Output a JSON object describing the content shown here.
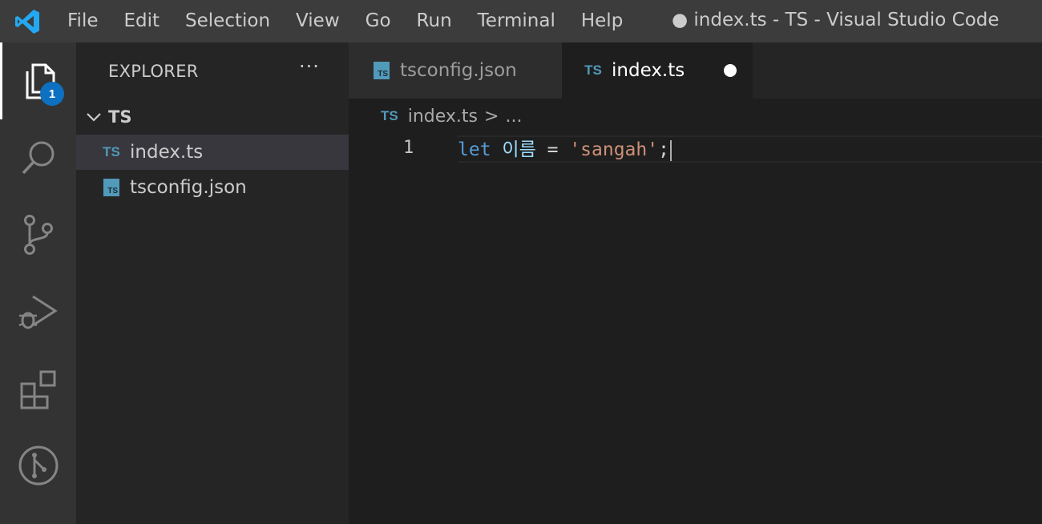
{
  "titlebar": {
    "menu": [
      "File",
      "Edit",
      "Selection",
      "View",
      "Go",
      "Run",
      "Terminal",
      "Help"
    ],
    "window_title": "● index.ts - TS - Visual Studio Code"
  },
  "activity_bar": {
    "items": [
      "explorer-icon",
      "search-icon",
      "source-control-icon",
      "run-debug-icon",
      "extensions-icon",
      "git-graph-icon"
    ],
    "explorer_badge": "1"
  },
  "sidebar": {
    "title": "EXPLORER",
    "more_label": "···",
    "folder": "TS",
    "files": [
      {
        "name": "index.ts",
        "icon": "TS"
      },
      {
        "name": "tsconfig.json",
        "icon": "TS"
      }
    ]
  },
  "tabs": [
    {
      "label": "tsconfig.json",
      "icon": "TS"
    },
    {
      "label": "index.ts",
      "icon": "TS"
    }
  ],
  "breadcrumb": {
    "icon": "TS",
    "file": "index.ts",
    "separator": ">",
    "rest": "..."
  },
  "editor": {
    "line_number": "1",
    "code": {
      "keyword": "let",
      "variable": "이름",
      "operator": "=",
      "string": "'sangah'",
      "end": ";"
    }
  },
  "colors": {
    "accent": "#0e70c0",
    "ts_icon": "#519aba",
    "keyword": "#569cd6",
    "string": "#ce9178"
  }
}
